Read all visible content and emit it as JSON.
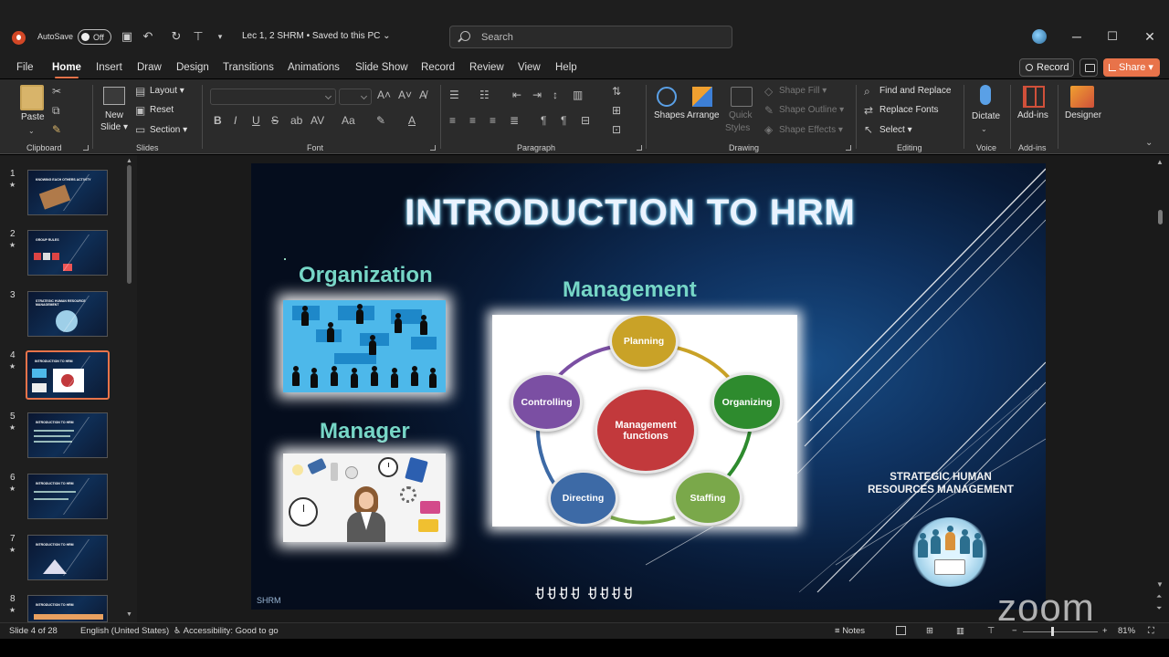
{
  "titlebar": {
    "autosave_label": "AutoSave",
    "autosave_state": "Off",
    "document_title": "Lec 1, 2 SHRM • Saved to this PC",
    "search_placeholder": "Search"
  },
  "ribbon_tabs": [
    "File",
    "Home",
    "Insert",
    "Draw",
    "Design",
    "Transitions",
    "Animations",
    "Slide Show",
    "Record",
    "Review",
    "View",
    "Help"
  ],
  "active_tab": "Home",
  "header_buttons": {
    "record": "Record",
    "share": "Share"
  },
  "ribbon": {
    "clipboard": {
      "paste": "Paste",
      "label": "Clipboard"
    },
    "slides": {
      "new_slide_1": "New",
      "new_slide_2": "Slide",
      "layout": "Layout",
      "reset": "Reset",
      "section": "Section",
      "label": "Slides"
    },
    "font": {
      "label": "Font"
    },
    "paragraph": {
      "label": "Paragraph"
    },
    "drawing": {
      "shapes": "Shapes",
      "arrange": "Arrange",
      "quick_styles_1": "Quick",
      "quick_styles_2": "Styles",
      "shape_fill": "Shape Fill",
      "shape_outline": "Shape Outline",
      "shape_effects": "Shape Effects",
      "label": "Drawing"
    },
    "editing": {
      "find_replace": "Find and Replace",
      "replace_fonts": "Replace Fonts",
      "select": "Select",
      "label": "Editing"
    },
    "voice": {
      "dictate": "Dictate",
      "label": "Voice"
    },
    "addins": {
      "addins": "Add-ins",
      "label": "Add-ins"
    },
    "designer": {
      "designer": "Designer"
    }
  },
  "thumbnails": {
    "numbers": [
      "1",
      "2",
      "3",
      "4",
      "5",
      "6",
      "7",
      "8"
    ],
    "titles": [
      "KNOWING EACH OTHERS ACTIVITY",
      "GROUP RULES",
      "STRATEGIC HUMAN RESOURCE MANAGEMENT",
      "INTRODUCTION TO HRM",
      "INTRODUCTION TO HRM",
      "INTRODUCTION TO HRM",
      "INTRODUCTION TO HRM",
      "INTRODUCTION TO HRM"
    ],
    "active_index": 4
  },
  "slide": {
    "title": "INTRODUCTION TO HRM",
    "organization": "Organization",
    "manager": "Manager",
    "management": "Management",
    "center_circle": "Management functions",
    "functions": [
      "Planning",
      "Organizing",
      "Staffing",
      "Directing",
      "Controlling"
    ],
    "function_colors": {
      "planning": "#c9a227",
      "organizing": "#2e8b2e",
      "staffing": "#7aa84a",
      "directing": "#3d6aa6",
      "controlling": "#7b4fa3",
      "center": "#c2393c"
    },
    "strategic_line1": "STRATEGIC HUMAN",
    "strategic_line2": "RESOURCES MANAGEMENT",
    "footer_left": "SHRM",
    "footer_center": "ꀀꀀꀀꀀ ꀀꀀꀀꀀ"
  },
  "statusbar": {
    "slide_counter": "Slide 4 of 28",
    "language": "English (United States)",
    "accessibility": "Accessibility: Good to go",
    "notes": "Notes",
    "zoom_level": "81%"
  },
  "watermark": "zoom",
  "colors": {
    "accent": "#e8734a",
    "title_glow": "#6fc6e8",
    "subtitle": "#76d6c6"
  }
}
